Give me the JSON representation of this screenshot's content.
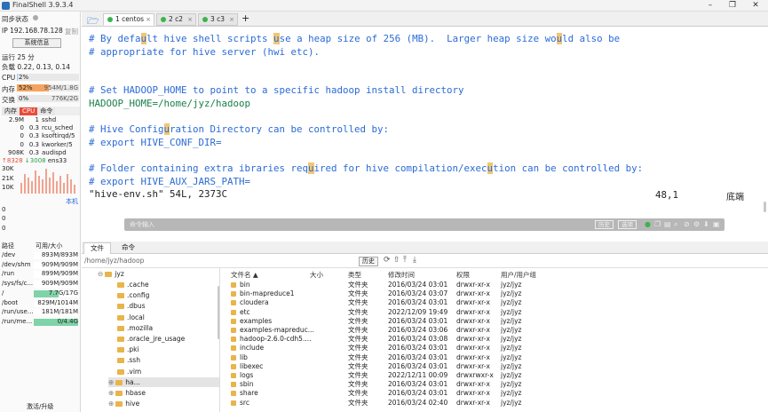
{
  "app": {
    "title": "FinalShell 3.9.3.4"
  },
  "left": {
    "sync_label": "同步状态",
    "ip_label": "IP 192.168.78.128",
    "copy_label": "复制",
    "sys_button": "系统信息",
    "uptime": "运行 25 分",
    "load": "负载 0.22, 0.13, 0.14",
    "cpu_label": "CPU",
    "cpu_value": "2%",
    "cpu_percent": 2,
    "mem_label": "内存",
    "mem_percent_text": "52%",
    "mem_percent": 52,
    "mem_value": "954M/1.8G",
    "swap_label": "交换",
    "swap_percent_text": "0%",
    "swap_value": "776K/2G",
    "proc_tabs": [
      "内存",
      "CPU",
      "命令"
    ],
    "processes": [
      {
        "mem": "2.9M",
        "cpu": "1",
        "cmd": "sshd"
      },
      {
        "mem": "0",
        "cpu": "0.3",
        "cmd": "rcu_sched"
      },
      {
        "mem": "0",
        "cpu": "0.3",
        "cmd": "ksoftirqd/5"
      },
      {
        "mem": "0",
        "cpu": "0.3",
        "cmd": "kworker/5"
      },
      {
        "mem": "908K",
        "cpu": "0.3",
        "cmd": "audispd"
      }
    ],
    "net_up": "↑8328",
    "net_down": "↓3008",
    "net_iface": "ens33",
    "net_axis": [
      "30K",
      "21K",
      "10K"
    ],
    "local_label": "本机",
    "latency": [
      "0",
      "0",
      "0"
    ],
    "disk_headers": [
      "路径",
      "可用/大小"
    ],
    "disks": [
      {
        "path": "/dev",
        "size": "893M/893M",
        "fill": 0
      },
      {
        "path": "/dev/shm",
        "size": "909M/909M",
        "fill": 0
      },
      {
        "path": "/run",
        "size": "899M/909M",
        "fill": 0
      },
      {
        "path": "/sys/fs/c...",
        "size": "909M/909M",
        "fill": 0
      },
      {
        "path": "/",
        "size": "7.7G/17G",
        "fill": 0.55
      },
      {
        "path": "/boot",
        "size": "829M/1014M",
        "fill": 0
      },
      {
        "path": "/run/use...",
        "size": "181M/181M",
        "fill": 0
      },
      {
        "path": "/run/me...",
        "size": "0/4.4G",
        "fill": 1
      }
    ],
    "upgrade": "激活/升级"
  },
  "tabs": [
    {
      "label": "1 centos",
      "close": "×"
    },
    {
      "label": "2 c2",
      "close": "×"
    },
    {
      "label": "3 c3",
      "close": "×"
    }
  ],
  "add_tab": "+",
  "terminal": {
    "lines": [
      {
        "pre": "# By defa",
        "h1": "u",
        "mid": "lt hive shell scripts ",
        "h2": "u",
        "post": "se a heap size of 256 (MB).  Larger heap size wo",
        "h3": "u",
        "end": "ld also be"
      },
      {
        "text": "# appropriate for hive server (hwi etc)."
      },
      {
        "text": ""
      },
      {
        "text": ""
      },
      {
        "text": "# Set HADOOP_HOME to point to a specific hadoop install directory"
      },
      {
        "text": "HADOOP_HOME=/home/jyz/hadoop"
      },
      {
        "text": ""
      },
      {
        "pre": "# Hive Config",
        "h1": "u",
        "mid": "ration Directory can be controlled by:",
        "h2": "",
        "post": "",
        "h3": "",
        "end": ""
      },
      {
        "text": "# export HIVE_CONF_DIR="
      },
      {
        "text": ""
      },
      {
        "pre": "# Folder containing extra ibraries req",
        "h1": "u",
        "mid": "ired for hive compilation/exec",
        "h2": "u",
        "post": "tion can be controlled by:",
        "h3": "",
        "end": ""
      },
      {
        "text": "# export HIVE_AUX_JARS_PATH="
      },
      {
        "text": "\"hive-env.sh\" 54L, 2373C"
      }
    ],
    "status_pos": "48,1",
    "status_end": "底端",
    "cmd_placeholder": "命令输入",
    "history_btn": "历史",
    "options_btn": "选项"
  },
  "bottom": {
    "tabs": [
      "文件",
      "命令"
    ],
    "path": "/home/jyz/hadoop",
    "history_btn": "历史",
    "tree_root": "jyz",
    "tree": [
      ".cache",
      ".config",
      ".dbus",
      ".local",
      ".mozilla",
      ".oracle_jre_usage",
      ".pki",
      ".ssh",
      ".vim",
      "ha...",
      "hbase",
      "hive"
    ],
    "file_headers": [
      "文件名 ▲",
      "大小",
      "类型",
      "修改时间",
      "权限",
      "用户/用户组"
    ],
    "files": [
      {
        "name": "bin",
        "size": "",
        "type": "文件夹",
        "time": "2016/03/24 03:01",
        "perm": "drwxr-xr-x",
        "owner": "jyz/jyz"
      },
      {
        "name": "bin-mapreduce1",
        "size": "",
        "type": "文件夹",
        "time": "2016/03/24 03:07",
        "perm": "drwxr-xr-x",
        "owner": "jyz/jyz"
      },
      {
        "name": "cloudera",
        "size": "",
        "type": "文件夹",
        "time": "2016/03/24 03:01",
        "perm": "drwxr-xr-x",
        "owner": "jyz/jyz"
      },
      {
        "name": "etc",
        "size": "",
        "type": "文件夹",
        "time": "2022/12/09 19:49",
        "perm": "drwxr-xr-x",
        "owner": "jyz/jyz"
      },
      {
        "name": "examples",
        "size": "",
        "type": "文件夹",
        "time": "2016/03/24 03:01",
        "perm": "drwxr-xr-x",
        "owner": "jyz/jyz"
      },
      {
        "name": "examples-mapreduc...",
        "size": "",
        "type": "文件夹",
        "time": "2016/03/24 03:06",
        "perm": "drwxr-xr-x",
        "owner": "jyz/jyz"
      },
      {
        "name": "hadoop-2.6.0-cdh5....",
        "size": "",
        "type": "文件夹",
        "time": "2016/03/24 03:08",
        "perm": "drwxr-xr-x",
        "owner": "jyz/jyz"
      },
      {
        "name": "include",
        "size": "",
        "type": "文件夹",
        "time": "2016/03/24 03:01",
        "perm": "drwxr-xr-x",
        "owner": "jyz/jyz"
      },
      {
        "name": "lib",
        "size": "",
        "type": "文件夹",
        "time": "2016/03/24 03:01",
        "perm": "drwxr-xr-x",
        "owner": "jyz/jyz"
      },
      {
        "name": "libexec",
        "size": "",
        "type": "文件夹",
        "time": "2016/03/24 03:01",
        "perm": "drwxr-xr-x",
        "owner": "jyz/jyz"
      },
      {
        "name": "logs",
        "size": "",
        "type": "文件夹",
        "time": "2022/12/11 00:09",
        "perm": "drwxrwxr-x",
        "owner": "jyz/jyz"
      },
      {
        "name": "sbin",
        "size": "",
        "type": "文件夹",
        "time": "2016/03/24 03:01",
        "perm": "drwxr-xr-x",
        "owner": "jyz/jyz"
      },
      {
        "name": "share",
        "size": "",
        "type": "文件夹",
        "time": "2016/03/24 03:01",
        "perm": "drwxr-xr-x",
        "owner": "jyz/jyz"
      },
      {
        "name": "src",
        "size": "",
        "type": "文件夹",
        "time": "2016/03/24 02:40",
        "perm": "drwxr-xr-x",
        "owner": "jyz/jyz"
      }
    ]
  },
  "colors": {
    "accent": "#2b6bd6",
    "highlight": "#f0c674",
    "mem_bar": "#f4a460",
    "tab_dot": "#3cb44b"
  }
}
